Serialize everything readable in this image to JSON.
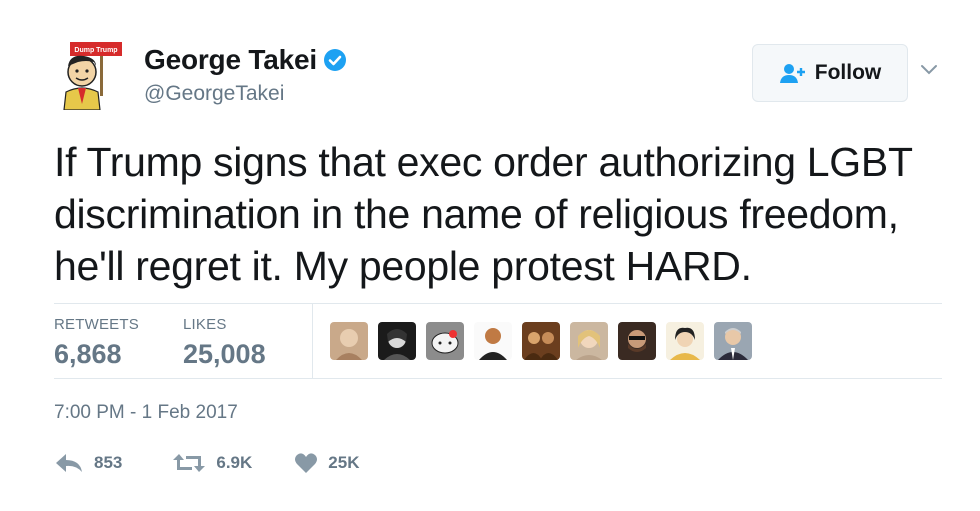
{
  "user": {
    "display_name": "George Takei",
    "handle": "@GeorgeTakei",
    "verified": true,
    "avatar_sign_text": "Dump Trump",
    "avatar_icon": "cartoon-avatar-icon"
  },
  "follow": {
    "label": "Follow",
    "icon": "follow-user-icon"
  },
  "tweet": {
    "text": "If Trump signs that exec order authorizing LGBT discrimination in the name of religious freedom, he'll regret it. My people protest HARD."
  },
  "stats": {
    "retweets_label": "RETWEETS",
    "retweets_value": "6,868",
    "likes_label": "LIKES",
    "likes_value": "25,008"
  },
  "likers": [
    {
      "icon": "liker-avatar-1"
    },
    {
      "icon": "liker-avatar-2"
    },
    {
      "icon": "liker-avatar-3"
    },
    {
      "icon": "liker-avatar-4"
    },
    {
      "icon": "liker-avatar-5"
    },
    {
      "icon": "liker-avatar-6"
    },
    {
      "icon": "liker-avatar-7"
    },
    {
      "icon": "liker-avatar-8"
    },
    {
      "icon": "liker-avatar-9"
    }
  ],
  "timestamp": "7:00 PM - 1 Feb 2017",
  "actions": {
    "reply_count": "853",
    "retweet_count": "6.9K",
    "like_count": "25K"
  },
  "colors": {
    "text": "#14171a",
    "muted": "#657786",
    "verified": "#1da1f2",
    "border": "#e1e8ed"
  }
}
